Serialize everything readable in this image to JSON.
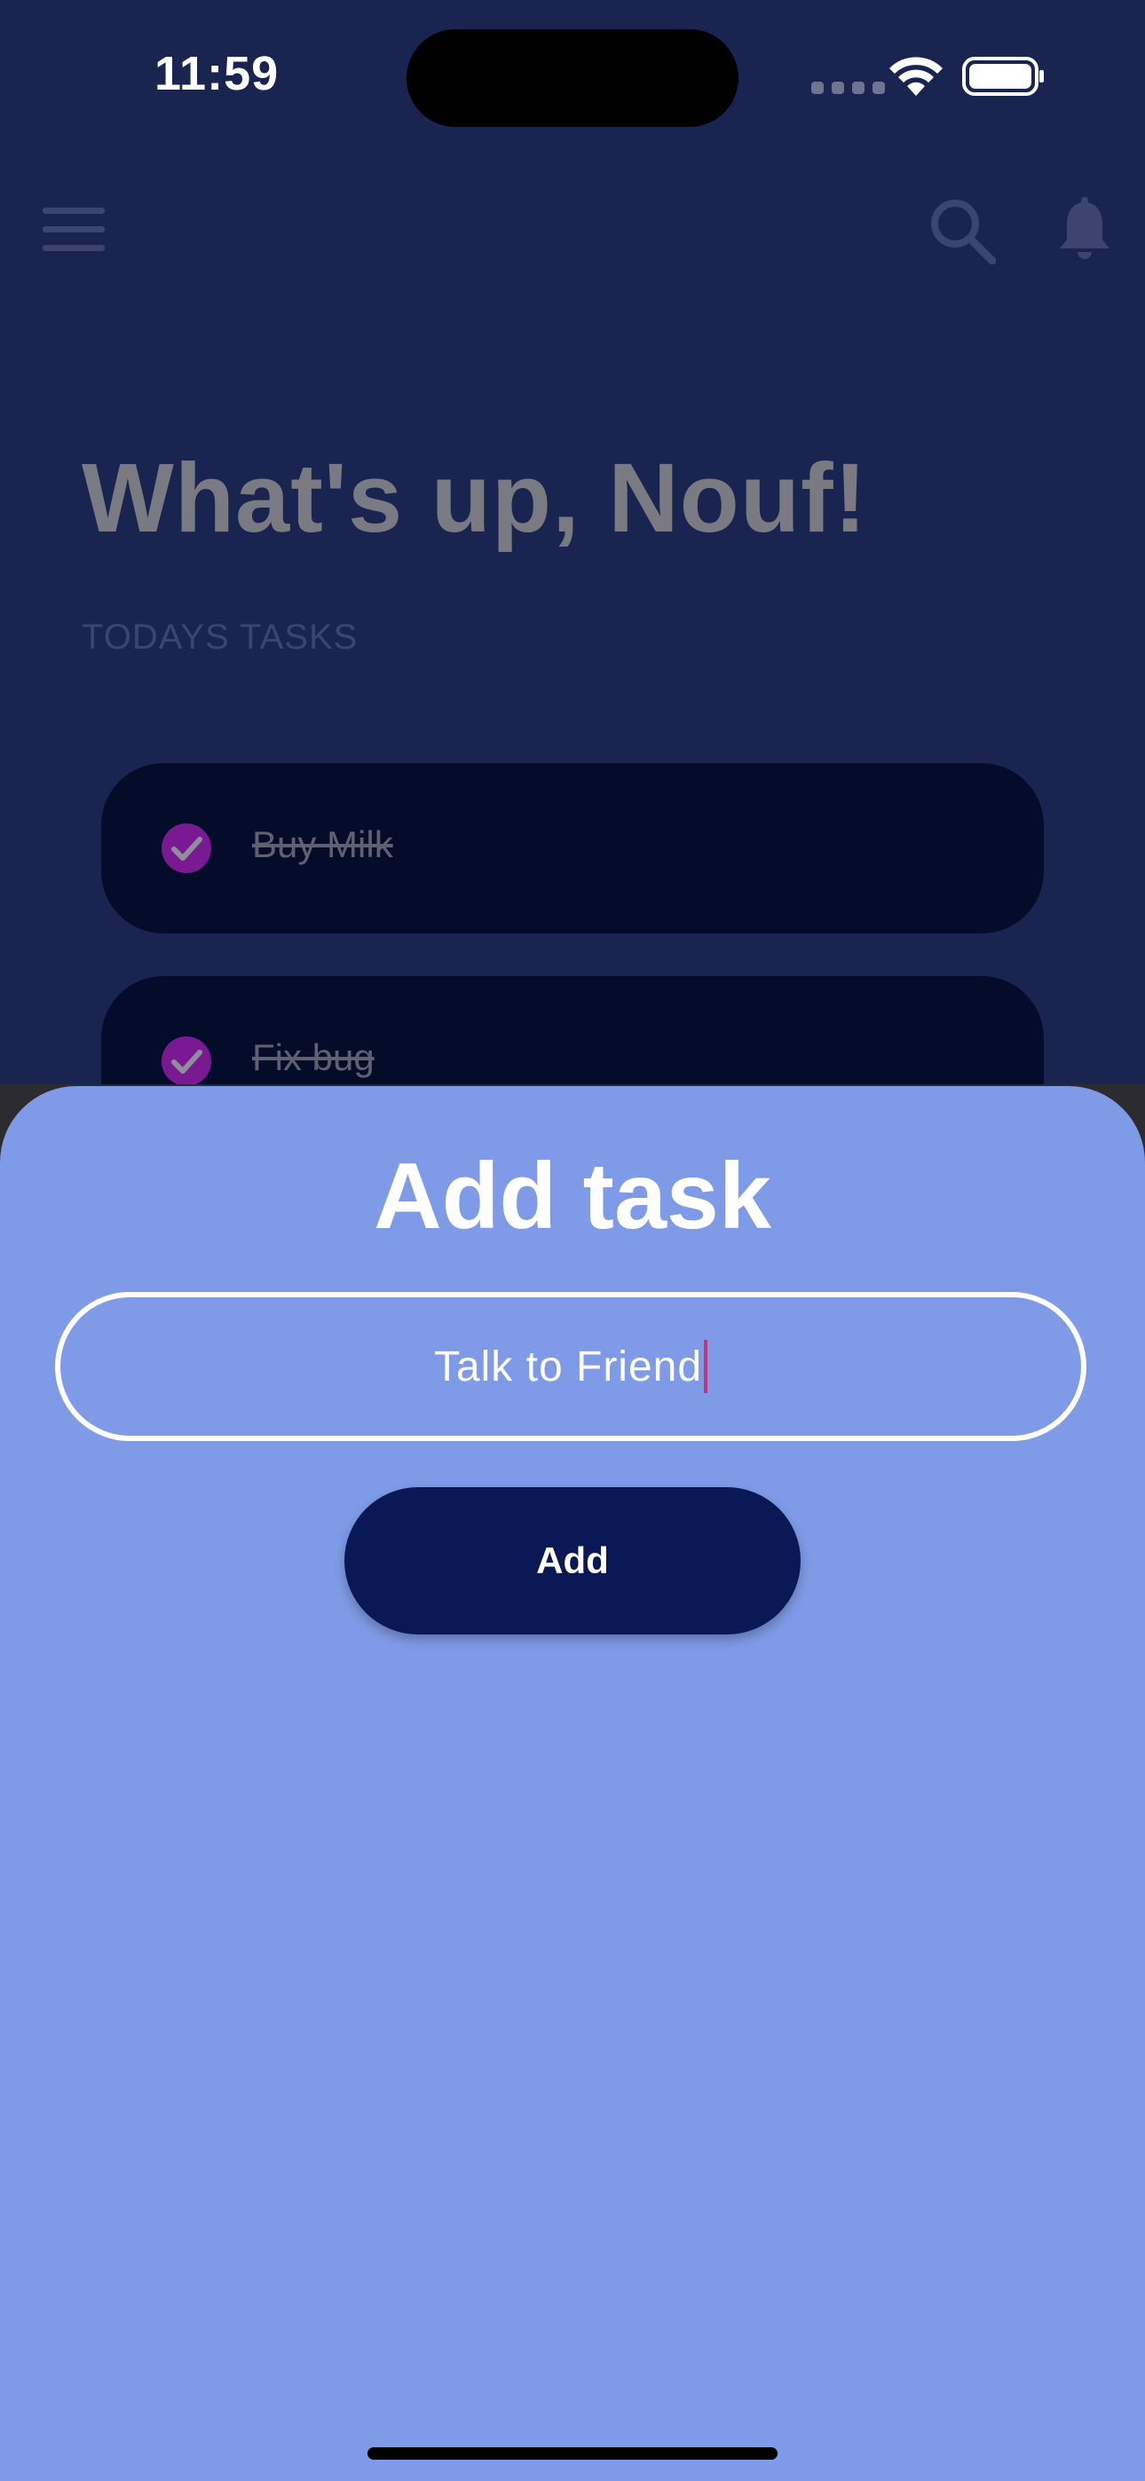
{
  "status_bar": {
    "time": "11:59"
  },
  "app_bar": {
    "menu_icon": "menu-icon",
    "search_icon": "search-icon",
    "notification_icon": "bell-icon"
  },
  "home": {
    "greeting": "What's up, Nouf!",
    "section_label": "TODAYS TASKS",
    "tasks": [
      {
        "label": "Buy Milk",
        "done": true
      },
      {
        "label": "Fix bug",
        "done": true
      }
    ]
  },
  "sheet": {
    "title": "Add task",
    "input_value": "Talk to Friend",
    "add_label": "Add"
  },
  "colors": {
    "background": "#1a2450",
    "card": "#050c2a",
    "check": "#7a1a93",
    "sheet": "#7f9be7",
    "button": "#0a1856",
    "caret": "#c2357d"
  }
}
